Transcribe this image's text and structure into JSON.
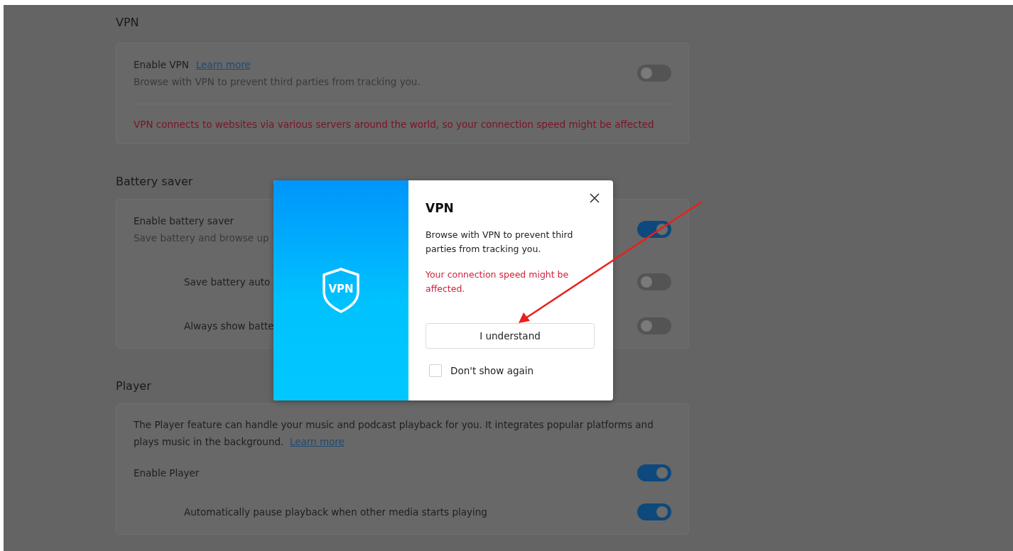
{
  "sections": [
    {
      "title": "VPN",
      "rows": [
        {
          "kind": "setting",
          "label": "Enable VPN",
          "link": "Learn more",
          "description": "Browse with VPN to prevent third parties from tracking you.",
          "on": false
        },
        {
          "kind": "warning",
          "text": "VPN connects to websites via various servers around the world, so your connection speed might be affected"
        }
      ]
    },
    {
      "title": "Battery saver",
      "rows": [
        {
          "kind": "setting",
          "label": "Enable battery saver",
          "description": "Save battery and browse up",
          "on": true
        },
        {
          "kind": "subsetting",
          "label": "Save battery auto",
          "on": false
        },
        {
          "kind": "subsetting",
          "label": "Always show batte",
          "on": false
        }
      ]
    },
    {
      "title": "Player",
      "rows": [
        {
          "kind": "intro",
          "text": "The Player feature can handle your music and podcast playback for you. It integrates popular platforms and plays music in the background.",
          "link": "Learn more"
        },
        {
          "kind": "setting",
          "label": "Enable Player",
          "on": true
        },
        {
          "kind": "subsetting",
          "label": "Automatically pause playback when other media starts playing",
          "on": true
        }
      ]
    }
  ],
  "dialog": {
    "badge": "VPN",
    "title": "VPN",
    "text": "Browse with VPN to prevent third parties from tracking you.",
    "warning": "Your connection speed might be affected.",
    "button": "I understand",
    "checkbox": {
      "label": "Don't show again",
      "checked": false
    }
  }
}
